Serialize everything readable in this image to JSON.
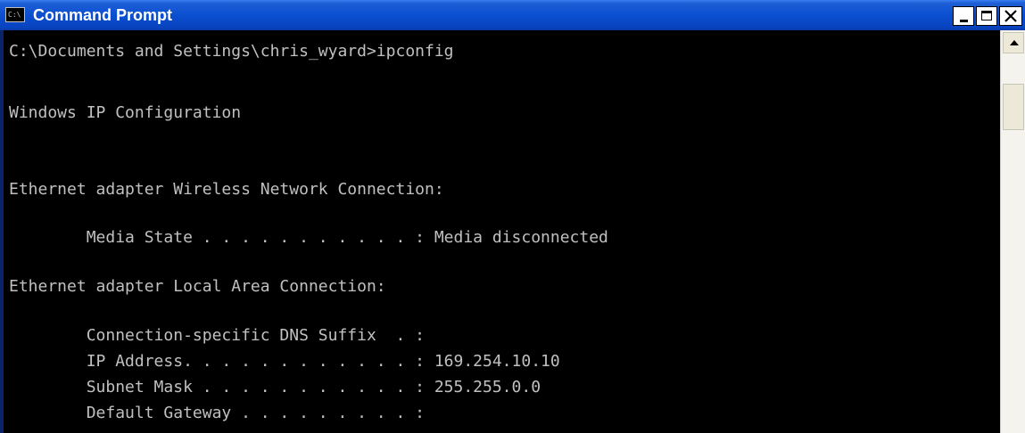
{
  "window": {
    "title": "Command Prompt",
    "app_icon_glyph": "C:\\",
    "app_icon_name": "console-icon"
  },
  "titlebar_buttons": {
    "minimize": "minimize",
    "maximize": "maximize",
    "close": "close"
  },
  "console": {
    "lines": [
      "C:\\Documents and Settings\\chris_wyard>ipconfig",
      "",
      "Windows IP Configuration",
      "",
      "",
      "Ethernet adapter Wireless Network Connection:",
      "",
      "        Media State . . . . . . . . . . . : Media disconnected",
      "",
      "Ethernet adapter Local Area Connection:",
      "",
      "        Connection-specific DNS Suffix  . :",
      "        IP Address. . . . . . . . . . . . : 169.254.10.10",
      "        Subnet Mask . . . . . . . . . . . : 255.255.0.0",
      "        Default Gateway . . . . . . . . . :"
    ]
  },
  "colors": {
    "titlebar_blue": "#0a4fd0",
    "console_bg": "#000000",
    "console_text": "#c0c0c0"
  }
}
